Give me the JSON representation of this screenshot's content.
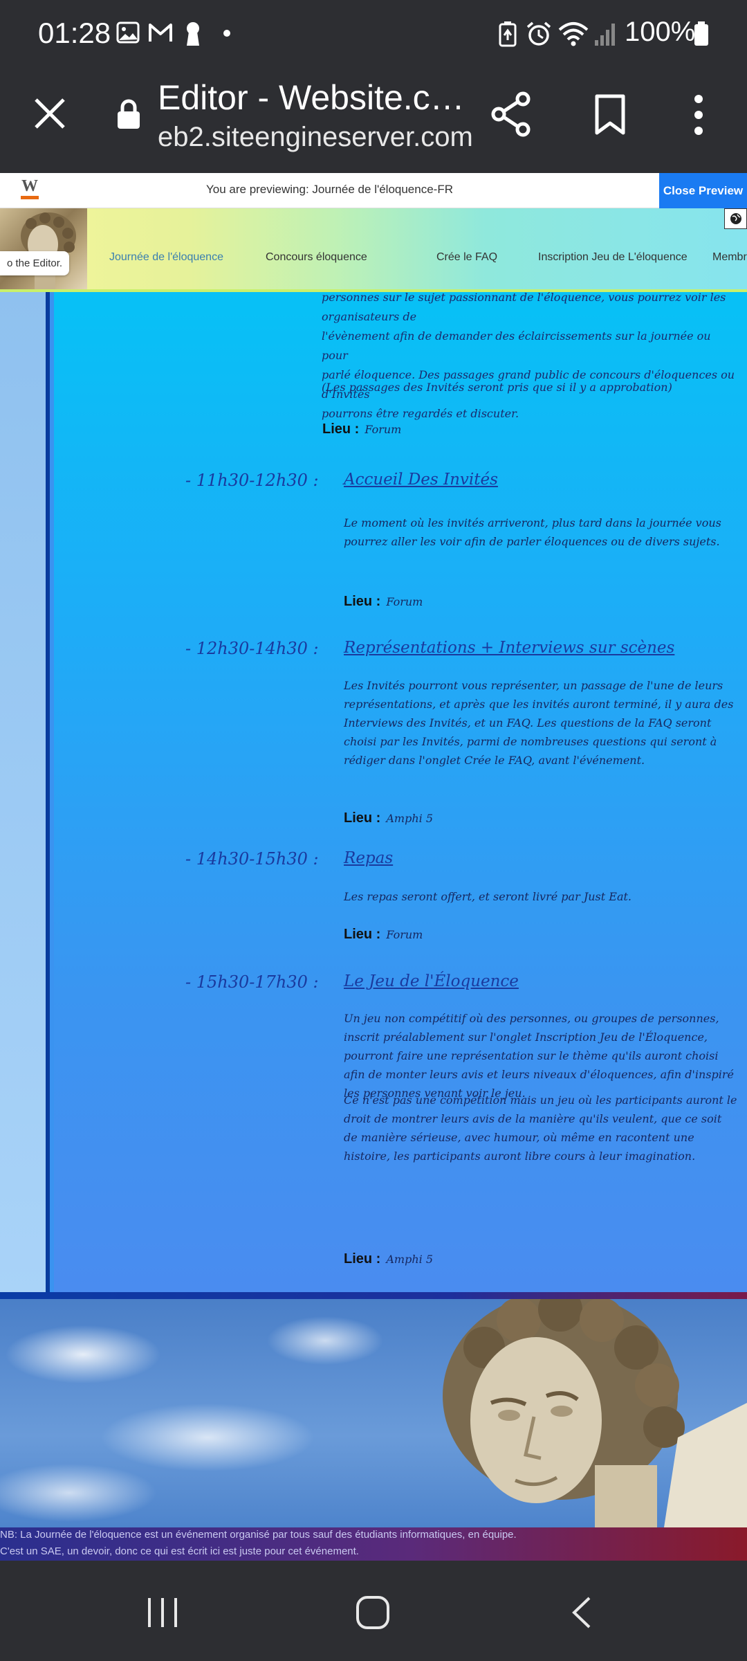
{
  "status_bar": {
    "time": "01:28",
    "battery": "100%",
    "icons": [
      "gallery-icon",
      "gmail-icon",
      "keyhole-icon",
      "dot-icon",
      "battery-saver-icon",
      "alarm-icon",
      "wifi-icon",
      "signal-icon",
      "battery-icon"
    ]
  },
  "browser": {
    "title": "Editor - Website.c…",
    "url": "eb2.siteengineserver.com",
    "icons": [
      "close-icon",
      "lock-icon",
      "share-icon",
      "bookmark-icon",
      "more-vert-icon"
    ]
  },
  "preview_bar": {
    "logo_letter": "W",
    "text": "You are previewing: Journée de l'éloquence-FR",
    "close_label": "Close Preview"
  },
  "site_header": {
    "tooltip": "o the Editor.",
    "nav": [
      "Journée de l'éloquence",
      "Concours éloquence",
      "Crée le FAQ",
      "Inscription Jeu de L'éloquence",
      "Membr"
    ],
    "active_color": "#3a7fb0"
  },
  "intro": {
    "lines": [
      "personnes sur le sujet passionnant de l'éloquence, vous pourrez voir les organisateurs de",
      "l'évènement afin de demander des éclaircissements sur la journée ou pour",
      "parlé éloquence. Des passages grand public de concours d'éloquences ou d'Invités",
      "pourrons être regardés et discuter."
    ],
    "note": "(Les passages des Invités seront pris que si il y a approbation)",
    "lieu_label": "Lieu :",
    "lieu_value": "Forum"
  },
  "events": [
    {
      "time": "- 11h30-12h30 :",
      "title": "Accueil Des Invités",
      "desc": [
        "Le moment où les invités arriveront, plus tard dans la journée vous pourrez aller les voir afin de parler éloquences ou de divers sujets."
      ],
      "lieu_label": "Lieu :",
      "lieu_value": "Forum"
    },
    {
      "time": "- 12h30-14h30 :",
      "title": "Représentations + Interviews sur scènes",
      "desc": [
        "Les Invités pourront vous représenter, un passage de l'une de leurs représentations, et après que les invités auront terminé, il y aura des Interviews des Invités, et un FAQ. Les questions de la FAQ seront choisi par les Invités, parmi de nombreuses questions qui seront à rédiger dans l'onglet Crée le FAQ, avant l'événement."
      ],
      "lieu_label": "Lieu :",
      "lieu_value": "Amphi 5"
    },
    {
      "time": "- 14h30-15h30 :",
      "title": "Repas",
      "desc": [
        "Les repas seront offert, et seront livré par Just Eat."
      ],
      "lieu_label": "Lieu :",
      "lieu_value": "Forum"
    },
    {
      "time": "- 15h30-17h30 :",
      "title": "Le Jeu de l'Éloquence",
      "desc": [
        "Un jeu non compétitif où des personnes, ou groupes de personnes, inscrit préalablement sur l'onglet Inscription Jeu de l'Éloquence, pourront faire une représentation sur le thème qu'ils auront choisi afin de monter leurs avis et leurs niveaux d'éloquences, afin d'inspiré les personnes venant voir le jeu.",
        "Ce n'est pas une compétition mais un jeu où les participants auront le droit de montrer leurs avis de la manière qu'ils veulent, que ce soit de manière sérieuse, avec humour, où même en racontent une histoire, les participants auront libre cours à leur imagination."
      ],
      "lieu_label": "Lieu :",
      "lieu_value": "Amphi 5"
    }
  ],
  "footer": {
    "line1": "NB: La Journée de l'éloquence est un événement organisé par tous sauf des étudiants informatiques, en équipe.",
    "line2": "C'est un SAE, un devoir, donc ce qui est écrit ici est juste pour cet événement."
  },
  "nav_bar": {
    "icons": [
      "recent-apps-icon",
      "home-icon",
      "back-icon"
    ]
  }
}
